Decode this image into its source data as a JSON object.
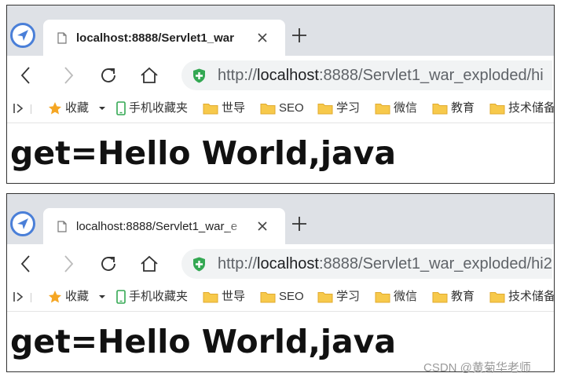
{
  "windows": [
    {
      "tab_title": "localhost:8888/Servlet1_war",
      "url_prefix": "http://",
      "url_host": "localhost",
      "url_rest": ":8888/Servlet1_war_exploded/hi",
      "page_text": "get=Hello World,java"
    },
    {
      "tab_title": "localhost:8888/Servlet1_war_e",
      "url_prefix": "http://",
      "url_host": "localhost",
      "url_rest": ":8888/Servlet1_war_exploded/hi2",
      "page_text": "get=Hello World,java"
    }
  ],
  "bookmarks": {
    "favorites": "收藏",
    "mobile": "手机收藏夹",
    "items": [
      "世导",
      "SEO",
      "学习",
      "微信",
      "教育",
      "技术储备"
    ]
  },
  "watermark": "CSDN @黄菊华老师",
  "colors": {
    "tab_strip": "#dee1e6",
    "address_bar": "#f1f3f4",
    "shield": "#34a853",
    "star": "#f5a623",
    "folder": "#f7c94b",
    "browser_logo": "#4a7fd8"
  }
}
